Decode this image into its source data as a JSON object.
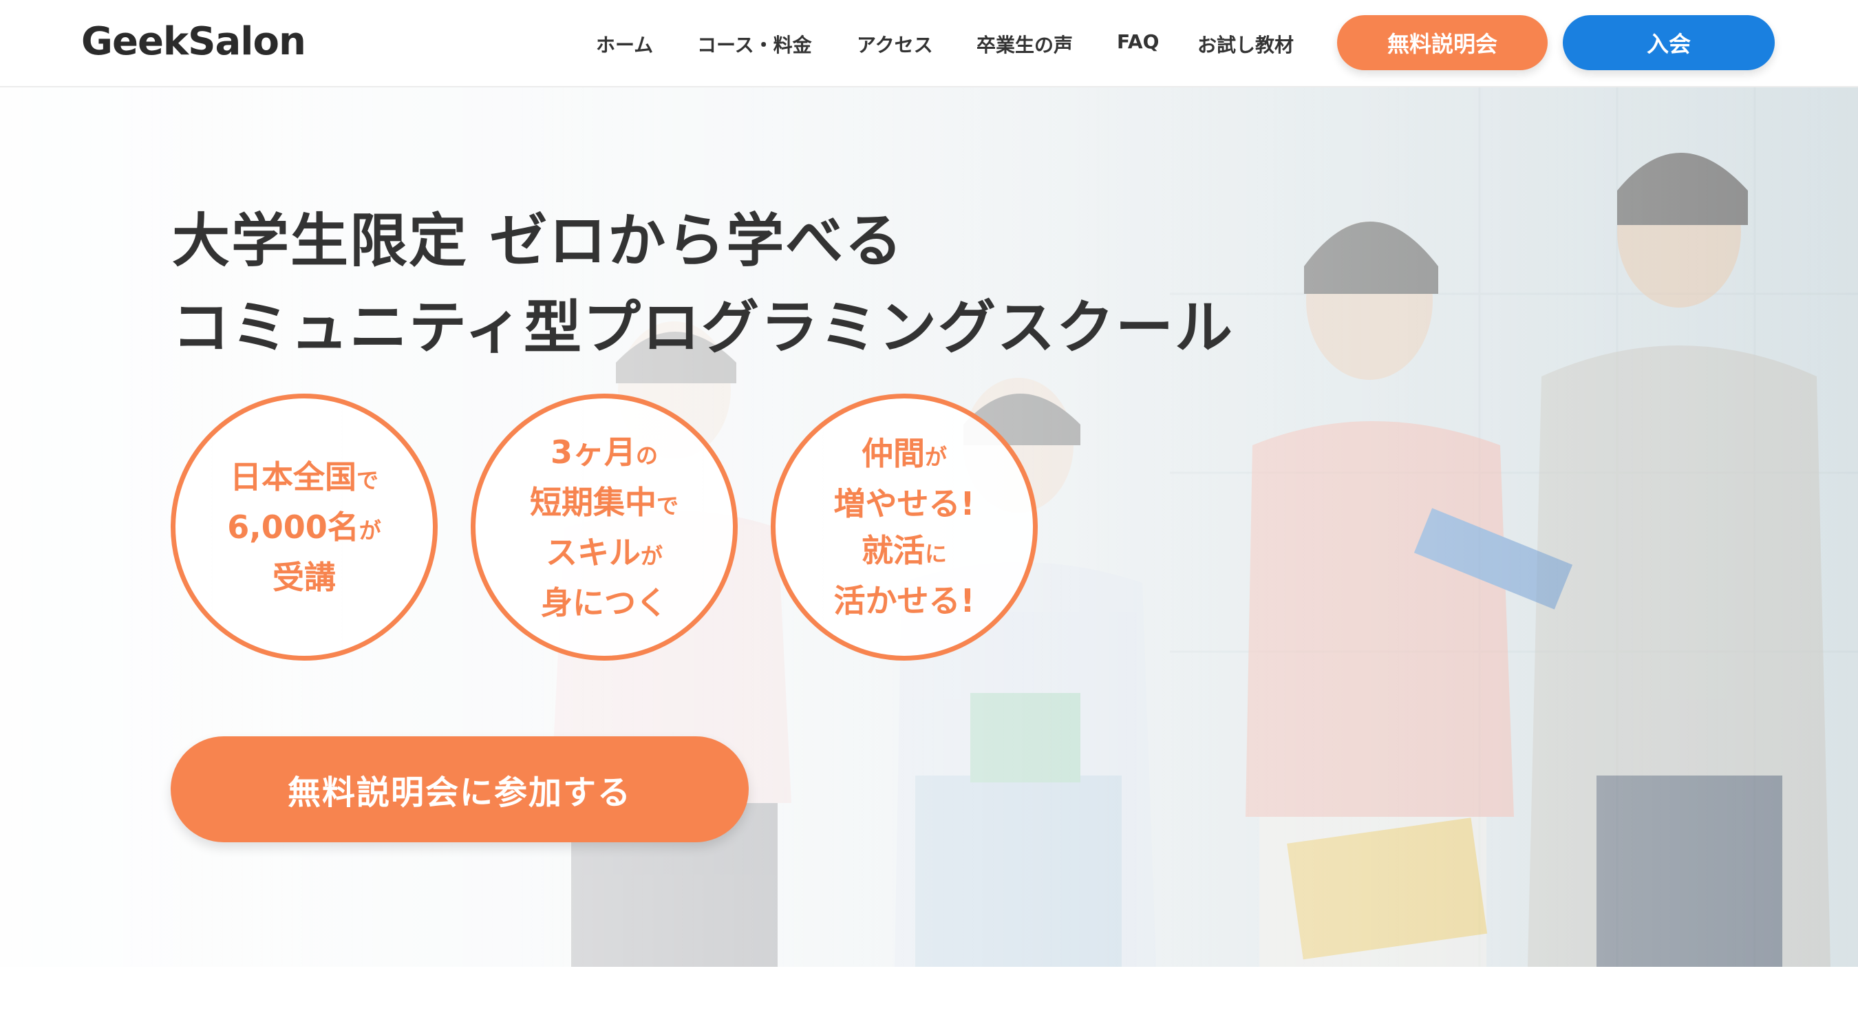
{
  "header": {
    "logo": "GeekSalon",
    "nav": [
      "ホーム",
      "コース・料金",
      "アクセス",
      "卒業生の声",
      "FAQ",
      "お試し教材"
    ],
    "seminar_button": "無料説明会",
    "join_button": "入会"
  },
  "hero": {
    "headline_line1": "大学生限定 ゼロから学べる",
    "headline_line2": "コミュニティ型プログラミングスクール",
    "circles": [
      {
        "l1a": "日本全国",
        "l1b": "で",
        "l2a": "6,000名",
        "l2b": "が",
        "l3a": "受講",
        "l3b": ""
      },
      {
        "l0a": "3ヶ月",
        "l0b": "の",
        "l1a": "短期集中",
        "l1b": "で",
        "l2a": "スキル",
        "l2b": "が",
        "l3a": "身につく",
        "l3b": ""
      },
      {
        "l0a": "仲間",
        "l0b": "が",
        "l1a": "増やせる!",
        "l1b": "",
        "l2a": "就活",
        "l2b": "に",
        "l3a": "活かせる!",
        "l3b": ""
      }
    ],
    "cta": "無料説明会に参加する"
  },
  "colors": {
    "accent_orange": "#f7844f",
    "accent_blue": "#1a80e0",
    "text_dark": "#333333"
  }
}
